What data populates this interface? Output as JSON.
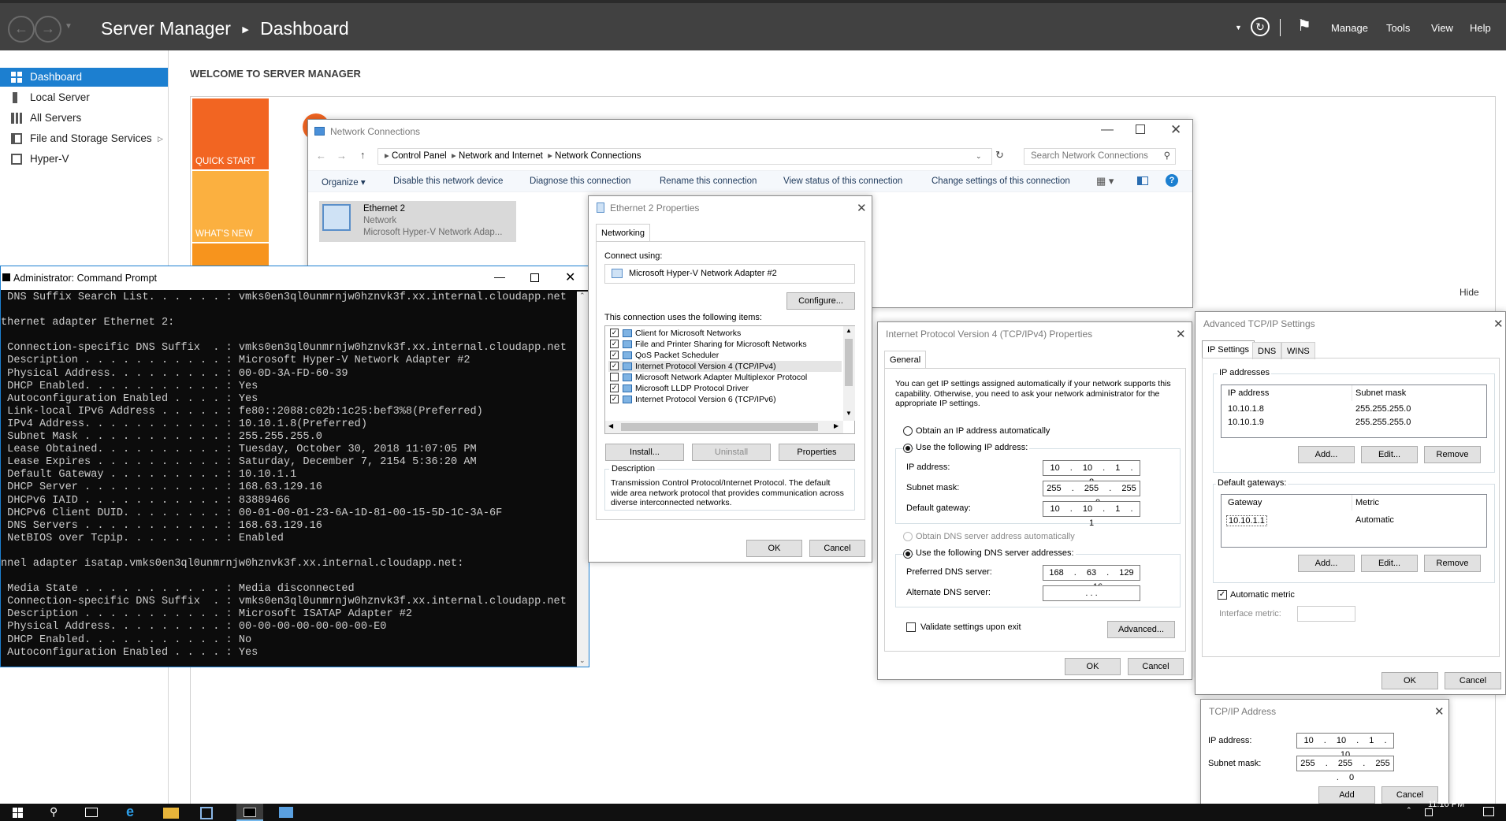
{
  "server_manager": {
    "title": "Server Manager",
    "breadcrumb": "Dashboard",
    "menu": [
      "Manage",
      "Tools",
      "View",
      "Help"
    ],
    "sidebar": [
      {
        "label": "Dashboard",
        "selected": true
      },
      {
        "label": "Local Server"
      },
      {
        "label": "All Servers"
      },
      {
        "label": "File and Storage Services"
      },
      {
        "label": "Hyper-V"
      }
    ],
    "welcome": "WELCOME TO SERVER MANAGER",
    "tiles": [
      "QUICK START",
      "WHAT'S NEW"
    ],
    "hide": "Hide",
    "accent": "#f26522"
  },
  "network_connections": {
    "title": "Network Connections",
    "path": [
      "Control Panel",
      "Network and Internet",
      "Network Connections"
    ],
    "search_placeholder": "Search Network Connections",
    "commands": [
      "Organize",
      "Disable this network device",
      "Diagnose this connection",
      "Rename this connection",
      "View status of this connection",
      "Change settings of this connection"
    ],
    "adapter": {
      "name": "Ethernet 2",
      "status": "Network",
      "device": "Microsoft Hyper-V Network Adap..."
    }
  },
  "cmd": {
    "title": "Administrator: Command Prompt",
    "lines": [
      "DNS Suffix Search List. . . . . . : vmks0en3ql0unmrnjw0hznvk3f.xx.internal.cloudapp.net",
      "",
      "thernet adapter Ethernet 2:",
      "",
      "Connection-specific DNS Suffix  . : vmks0en3ql0unmrnjw0hznvk3f.xx.internal.cloudapp.net",
      "Description . . . . . . . . . . . : Microsoft Hyper-V Network Adapter #2",
      "Physical Address. . . . . . . . . : 00-0D-3A-FD-60-39",
      "DHCP Enabled. . . . . . . . . . . : Yes",
      "Autoconfiguration Enabled . . . . : Yes",
      "Link-local IPv6 Address . . . . . : fe80::2088:c02b:1c25:bef3%8(Preferred)",
      "IPv4 Address. . . . . . . . . . . : 10.10.1.8(Preferred)",
      "Subnet Mask . . . . . . . . . . . : 255.255.255.0",
      "Lease Obtained. . . . . . . . . . : Tuesday, October 30, 2018 11:07:05 PM",
      "Lease Expires . . . . . . . . . . : Saturday, December 7, 2154 5:36:20 AM",
      "Default Gateway . . . . . . . . . : 10.10.1.1",
      "DHCP Server . . . . . . . . . . . : 168.63.129.16",
      "DHCPv6 IAID . . . . . . . . . . . : 83889466",
      "DHCPv6 Client DUID. . . . . . . . : 00-01-00-01-23-6A-1D-81-00-15-5D-1C-3A-6F",
      "DNS Servers . . . . . . . . . . . : 168.63.129.16",
      "NetBIOS over Tcpip. . . . . . . . : Enabled",
      "",
      "nnel adapter isatap.vmks0en3ql0unmrnjw0hznvk3f.xx.internal.cloudapp.net:",
      "",
      "Media State . . . . . . . . . . . : Media disconnected",
      "Connection-specific DNS Suffix  . : vmks0en3ql0unmrnjw0hznvk3f.xx.internal.cloudapp.net",
      "Description . . . . . . . . . . . : Microsoft ISATAP Adapter #2",
      "Physical Address. . . . . . . . . : 00-00-00-00-00-00-00-E0",
      "DHCP Enabled. . . . . . . . . . . : No",
      "Autoconfiguration Enabled . . . . : Yes"
    ]
  },
  "eth_props": {
    "title": "Ethernet 2 Properties",
    "tab": "Networking",
    "connect_using_label": "Connect using:",
    "adapter": "Microsoft Hyper-V Network Adapter #2",
    "configure": "Configure...",
    "items_label": "This connection uses the following items:",
    "items": [
      {
        "label": "Client for Microsoft Networks",
        "checked": true
      },
      {
        "label": "File and Printer Sharing for Microsoft Networks",
        "checked": true
      },
      {
        "label": "QoS Packet Scheduler",
        "checked": true
      },
      {
        "label": "Internet Protocol Version 4 (TCP/IPv4)",
        "checked": true
      },
      {
        "label": "Microsoft Network Adapter Multiplexor Protocol",
        "checked": false
      },
      {
        "label": "Microsoft LLDP Protocol Driver",
        "checked": true
      },
      {
        "label": "Internet Protocol Version 6 (TCP/IPv6)",
        "checked": true
      }
    ],
    "install": "Install...",
    "uninstall": "Uninstall",
    "properties": "Properties",
    "desc_label": "Description",
    "desc": "Transmission Control Protocol/Internet Protocol. The default wide area network protocol that provides communication across diverse interconnected networks.",
    "ok": "OK",
    "cancel": "Cancel"
  },
  "ipv4": {
    "title": "Internet Protocol Version 4 (TCP/IPv4) Properties",
    "tab": "General",
    "intro": "You can get IP settings assigned automatically if your network supports this capability. Otherwise, you need to ask your network administrator for the appropriate IP settings.",
    "auto_ip": "Obtain an IP address automatically",
    "use_ip": "Use the following IP address:",
    "ip_label": "IP address:",
    "ip": "10 . 10 . 1 . 8",
    "mask_label": "Subnet mask:",
    "mask": "255 . 255 . 255 . 0",
    "gw_label": "Default gateway:",
    "gw": "10 . 10 . 1 . 1",
    "auto_dns": "Obtain DNS server address automatically",
    "use_dns": "Use the following DNS server addresses:",
    "pdns_label": "Preferred DNS server:",
    "pdns": "168 . 63 . 129 . 16",
    "adns_label": "Alternate DNS server:",
    "adns": ".   .   .",
    "validate": "Validate settings upon exit",
    "advanced": "Advanced...",
    "ok": "OK",
    "cancel": "Cancel"
  },
  "adv": {
    "title": "Advanced TCP/IP Settings",
    "tabs": [
      "IP Settings",
      "DNS",
      "WINS"
    ],
    "ip_group": "IP addresses",
    "ip_cols": [
      "IP address",
      "Subnet mask"
    ],
    "ip_rows": [
      [
        "10.10.1.8",
        "255.255.255.0"
      ],
      [
        "10.10.1.9",
        "255.255.255.0"
      ]
    ],
    "gw_group": "Default gateways:",
    "gw_cols": [
      "Gateway",
      "Metric"
    ],
    "gw_rows": [
      [
        "10.10.1.1",
        "Automatic"
      ]
    ],
    "add": "Add...",
    "edit": "Edit...",
    "remove": "Remove",
    "auto_metric": "Automatic metric",
    "iface_metric": "Interface metric:",
    "ok": "OK",
    "cancel": "Cancel"
  },
  "tcpip_addr": {
    "title": "TCP/IP Address",
    "ip_label": "IP address:",
    "ip": "10 . 10 . 1 . 10",
    "mask_label": "Subnet mask:",
    "mask": "255 . 255 . 255 . 0",
    "add": "Add",
    "cancel": "Cancel"
  },
  "taskbar": {
    "clock": "11:10 PM"
  }
}
